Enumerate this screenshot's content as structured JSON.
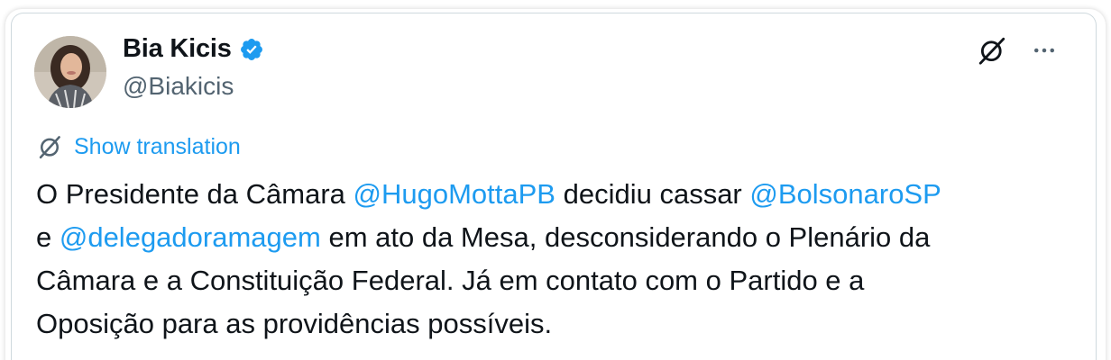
{
  "author": {
    "display_name": "Bia Kicis",
    "handle": "@Biakicis",
    "verified": true
  },
  "actions": {
    "grok_icon": "grok-icon",
    "more_icon": "more-options-icon"
  },
  "translate": {
    "icon": "translate-icon",
    "label": "Show translation"
  },
  "tweet": {
    "line1_pre": "O Presidente da Câmara ",
    "mention1": "@HugoMottaPB",
    "line1_mid": " decidiu cassar ",
    "mention2": "@BolsonaroSP",
    "line2_pre": "e ",
    "mention3": "@delegadoramagem",
    "line2_post": " em ato da Mesa, desconsiderando o Plenário da",
    "line3": "Câmara e a Constituição Federal. Já em contato com o Partido e a",
    "line4": "Oposição para as providências possíveis."
  },
  "colors": {
    "link": "#1d9bf0",
    "text": "#0f1419",
    "secondary": "#536471",
    "border": "#cfd9de"
  }
}
